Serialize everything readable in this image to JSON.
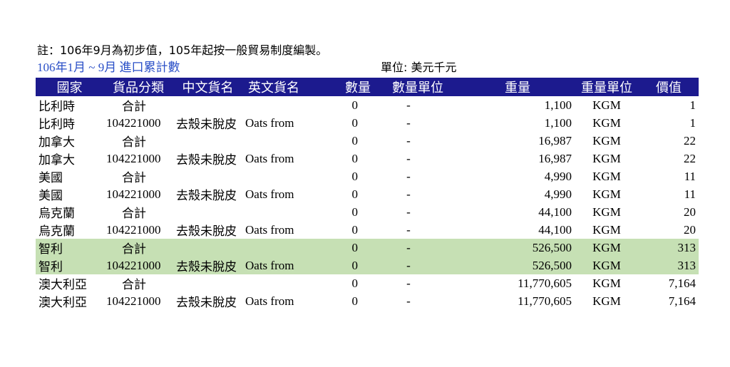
{
  "note": "註：106年9月為初步值，105年起按一般貿易制度編製。",
  "subtitle": "106年1月 ~ 9月 進口累計數",
  "unit_label": "單位: 美元千元",
  "headers": [
    "國家",
    "貨品分類",
    "中文貨名",
    "英文貨名",
    "數量",
    "數量單位",
    "重量",
    "重量單位",
    "價值"
  ],
  "highlight_color": "#c6e0b4",
  "header_bg": "#1c1a8e",
  "rows": [
    {
      "country": "比利時",
      "code": "合計",
      "cname": "",
      "ename": "",
      "qty": "0",
      "qunit": "-",
      "weight": "1,100",
      "wunit": "KGM",
      "value": "1"
    },
    {
      "country": "比利時",
      "code": "104221000",
      "cname": "去殼未脫皮",
      "ename": "Oats from",
      "qty": "0",
      "qunit": "-",
      "weight": "1,100",
      "wunit": "KGM",
      "value": "1"
    },
    {
      "country": "加拿大",
      "code": "合計",
      "cname": "",
      "ename": "",
      "qty": "0",
      "qunit": "-",
      "weight": "16,987",
      "wunit": "KGM",
      "value": "22"
    },
    {
      "country": "加拿大",
      "code": "104221000",
      "cname": "去殼未脫皮",
      "ename": "Oats from",
      "qty": "0",
      "qunit": "-",
      "weight": "16,987",
      "wunit": "KGM",
      "value": "22"
    },
    {
      "country": "美國",
      "code": "合計",
      "cname": "",
      "ename": "",
      "qty": "0",
      "qunit": "-",
      "weight": "4,990",
      "wunit": "KGM",
      "value": "11"
    },
    {
      "country": "美國",
      "code": "104221000",
      "cname": "去殼未脫皮",
      "ename": "Oats from",
      "qty": "0",
      "qunit": "-",
      "weight": "4,990",
      "wunit": "KGM",
      "value": "11"
    },
    {
      "country": "烏克蘭",
      "code": "合計",
      "cname": "",
      "ename": "",
      "qty": "0",
      "qunit": "-",
      "weight": "44,100",
      "wunit": "KGM",
      "value": "20"
    },
    {
      "country": "烏克蘭",
      "code": "104221000",
      "cname": "去殼未脫皮",
      "ename": "Oats from",
      "qty": "0",
      "qunit": "-",
      "weight": "44,100",
      "wunit": "KGM",
      "value": "20"
    },
    {
      "country": "智利",
      "code": "合計",
      "cname": "",
      "ename": "",
      "qty": "0",
      "qunit": "-",
      "weight": "526,500",
      "wunit": "KGM",
      "value": "313",
      "highlight": true
    },
    {
      "country": "智利",
      "code": "104221000",
      "cname": "去殼未脫皮",
      "ename": "Oats from",
      "qty": "0",
      "qunit": "-",
      "weight": "526,500",
      "wunit": "KGM",
      "value": "313",
      "highlight": true
    },
    {
      "country": "澳大利亞",
      "code": "合計",
      "cname": "",
      "ename": "",
      "qty": "0",
      "qunit": "-",
      "weight": "11,770,605",
      "wunit": "KGM",
      "value": "7,164"
    },
    {
      "country": "澳大利亞",
      "code": "104221000",
      "cname": "去殼未脫皮",
      "ename": "Oats from",
      "qty": "0",
      "qunit": "-",
      "weight": "11,770,605",
      "wunit": "KGM",
      "value": "7,164"
    }
  ]
}
